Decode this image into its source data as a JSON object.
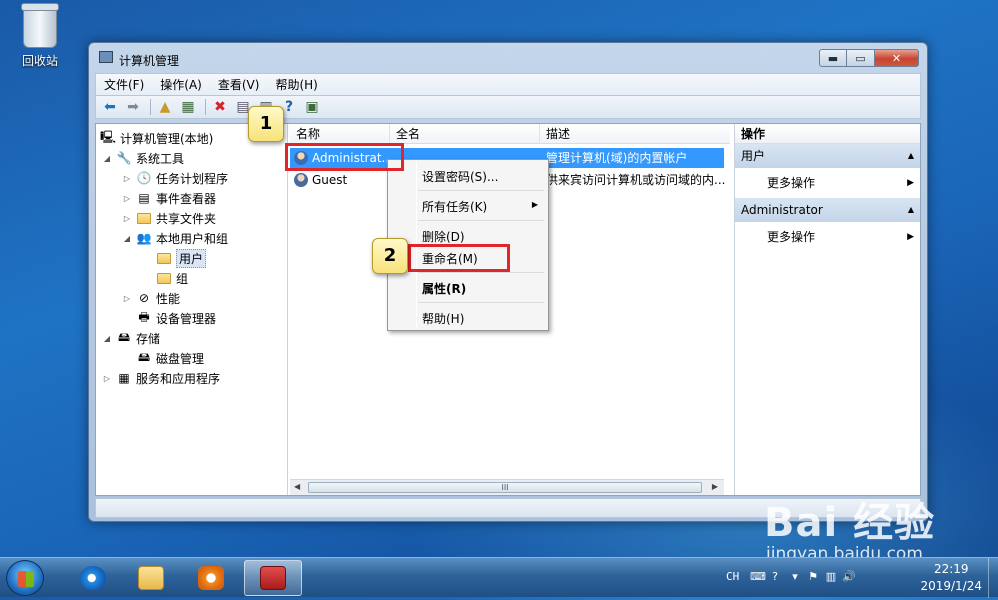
{
  "desktop": {
    "recycle_bin_label": "回收站"
  },
  "window": {
    "title": "计算机管理",
    "buttons": {
      "minimize": "▬",
      "maximize": "▭",
      "close": "✕"
    }
  },
  "menu": [
    "文件(F)",
    "操作(A)",
    "查看(V)",
    "帮助(H)"
  ],
  "toolbar": {
    "icons": [
      "back-icon",
      "forward-icon",
      "up-folder-icon",
      "show-hide-tree-icon",
      "delete-icon",
      "properties-icon",
      "export-list-icon",
      "help-icon",
      "show-hide-action-pane-icon"
    ]
  },
  "tree": {
    "root": "计算机管理(本地)",
    "system_tools": "系统工具",
    "task_scheduler": "任务计划程序",
    "event_viewer": "事件查看器",
    "shared_folders": "共享文件夹",
    "local_users_groups": "本地用户和组",
    "users": "用户",
    "groups": "组",
    "performance": "性能",
    "device_manager": "设备管理器",
    "storage": "存储",
    "disk_management": "磁盘管理",
    "services_apps": "服务和应用程序"
  },
  "list": {
    "columns": [
      "名称",
      "全名",
      "描述"
    ],
    "rows": [
      {
        "name": "Administrat...",
        "fullname": "",
        "description": "管理计算机(域)的内置帐户"
      },
      {
        "name": "Guest",
        "fullname": "",
        "description": "供来宾访问计算机或访问域的内..."
      }
    ],
    "scroll_glyph": "III"
  },
  "actions": {
    "header": "操作",
    "sections": [
      {
        "title": "用户",
        "item": "更多操作"
      },
      {
        "title": "Administrator",
        "item": "更多操作"
      }
    ]
  },
  "context_menu": {
    "set_password": "设置密码(S)...",
    "all_tasks": "所有任务(K)",
    "delete": "删除(D)",
    "rename": "重命名(M)",
    "properties": "属性(R)",
    "help": "帮助(H)"
  },
  "annotations": {
    "badge1": "1",
    "badge2": "2"
  },
  "watermark": {
    "main": "Bai 经验",
    "sub": "jingyan.baidu.com"
  },
  "taskbar": {
    "lang": "CH",
    "time": "22:19",
    "date": "2019/1/24"
  },
  "colors": {
    "selection": "#3399ff",
    "highlight_border": "#e0262b",
    "badge_fill": "#f7e37a"
  }
}
